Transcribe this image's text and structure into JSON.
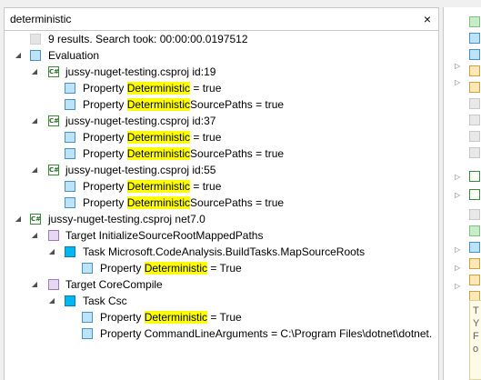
{
  "search": {
    "value": "deterministic",
    "clear_icon": "×"
  },
  "tree": {
    "summary": "9 results. Search took: 00:00:00.0197512",
    "evaluation_label": "Evaluation",
    "eval_projects": [
      {
        "label": "jussy-nuget-testing.csproj id:19",
        "props": [
          {
            "pre": "Property ",
            "hl": "Deterministic",
            "post": " = true"
          },
          {
            "pre": "Property ",
            "hl": "Deterministic",
            "post": "SourcePaths = true"
          }
        ]
      },
      {
        "label": "jussy-nuget-testing.csproj id:37",
        "props": [
          {
            "pre": "Property ",
            "hl": "Deterministic",
            "post": " = true"
          },
          {
            "pre": "Property ",
            "hl": "Deterministic",
            "post": "SourcePaths = true"
          }
        ]
      },
      {
        "label": "jussy-nuget-testing.csproj id:55",
        "props": [
          {
            "pre": "Property ",
            "hl": "Deterministic",
            "post": " = true"
          },
          {
            "pre": "Property ",
            "hl": "Deterministic",
            "post": "SourcePaths = true"
          }
        ]
      }
    ],
    "build_project": "jussy-nuget-testing.csproj net7.0",
    "target1": "Target InitializeSourceRootMappedPaths",
    "task1": "Task Microsoft.CodeAnalysis.BuildTasks.MapSourceRoots",
    "task1_prop": {
      "pre": "Property ",
      "hl": "Deterministic",
      "post": " = True"
    },
    "target2": "Target CoreCompile",
    "task2": "Task Csc",
    "task2_prop1": {
      "pre": "Property ",
      "hl": "Deterministic",
      "post": " = True"
    },
    "task2_prop2": "Property CommandLineArguments = C:\\Program Files\\dotnet\\dotnet.",
    "project_icon_text": "C#"
  },
  "right_pane": {
    "note_lines": [
      "T",
      "Y",
      "F",
      "o"
    ]
  }
}
